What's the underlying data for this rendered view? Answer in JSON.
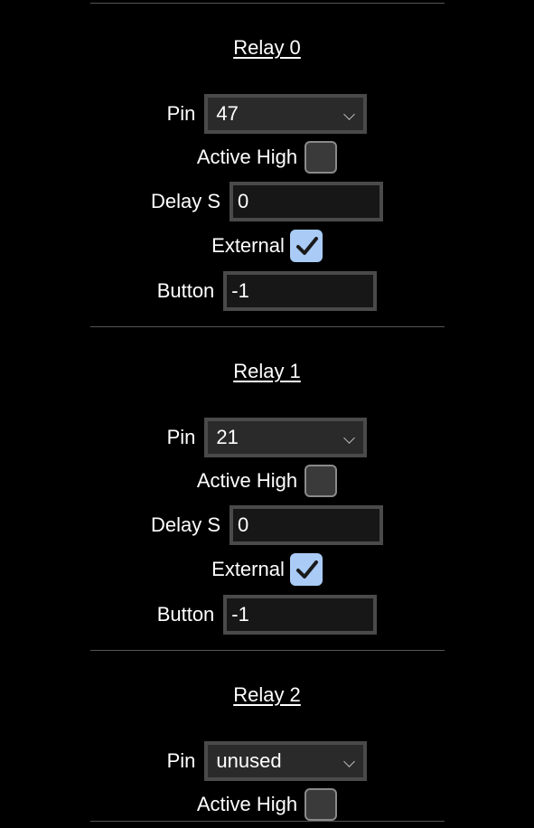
{
  "relays": [
    {
      "title": "Relay 0",
      "pin_label": "Pin",
      "pin_value": "47",
      "active_high_label": "Active High",
      "active_high_checked": false,
      "delay_label": "Delay S",
      "delay_value": "0",
      "external_label": "External",
      "external_checked": true,
      "button_label": "Button",
      "button_value": "-1"
    },
    {
      "title": "Relay 1",
      "pin_label": "Pin",
      "pin_value": "21",
      "active_high_label": "Active High",
      "active_high_checked": false,
      "delay_label": "Delay S",
      "delay_value": "0",
      "external_label": "External",
      "external_checked": true,
      "button_label": "Button",
      "button_value": "-1"
    },
    {
      "title": "Relay 2",
      "pin_label": "Pin",
      "pin_value": "unused",
      "active_high_label": "Active High",
      "active_high_checked": false
    }
  ],
  "colors": {
    "background": "#000000",
    "checkbox_checked": "#a9cbf6",
    "field_border": "#4a4a4a"
  },
  "icons": {
    "dropdown": "chevron-down-icon",
    "check": "checkmark-icon"
  }
}
